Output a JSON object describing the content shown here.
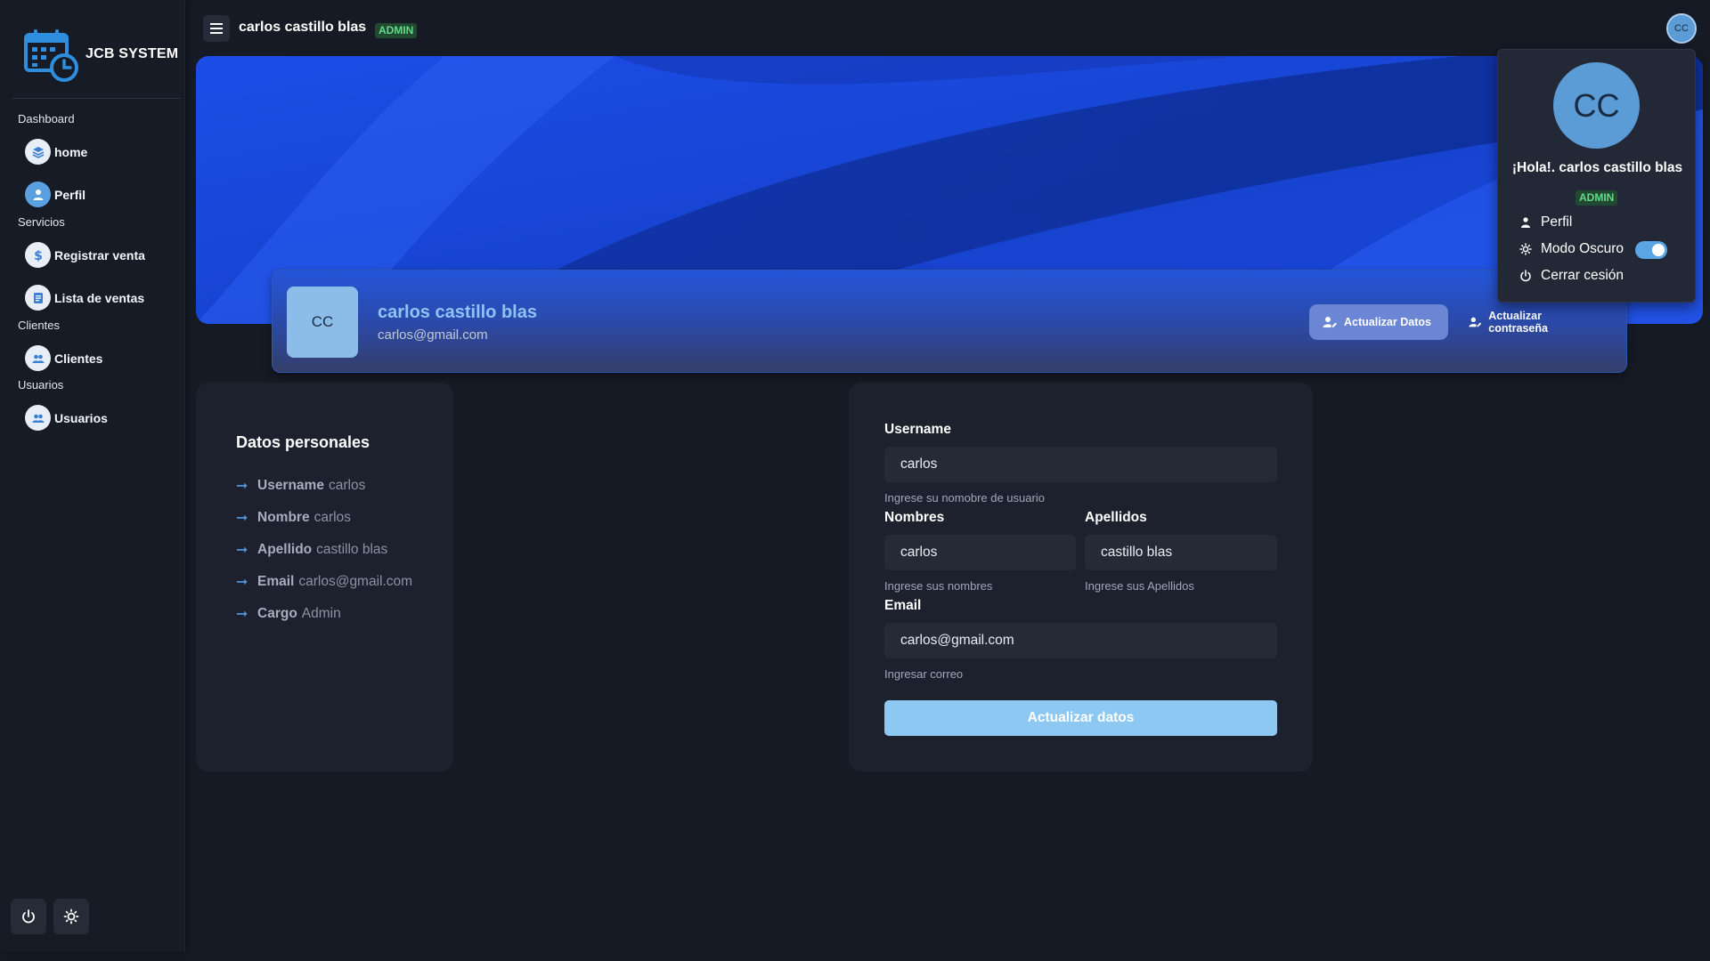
{
  "app": {
    "brand": "JCB SYSTEM"
  },
  "sidebar": {
    "sections": [
      {
        "title": "Dashboard",
        "items": [
          {
            "label": "home",
            "icon": "layers-icon"
          },
          {
            "label": "Perfil",
            "icon": "user-icon",
            "active": true
          }
        ]
      },
      {
        "title": "Servicios",
        "items": [
          {
            "label": "Registrar venta",
            "icon": "dollar-icon"
          },
          {
            "label": "Lista de ventas",
            "icon": "document-icon"
          }
        ]
      },
      {
        "title": "Clientes",
        "items": [
          {
            "label": "Clientes",
            "icon": "users-icon"
          }
        ]
      },
      {
        "title": "Usuarios",
        "items": [
          {
            "label": "Usuarios",
            "icon": "users-icon"
          }
        ]
      }
    ],
    "footer_buttons": [
      "power-icon",
      "sun-icon"
    ]
  },
  "header": {
    "user_name": "carlos castillo blas",
    "role_badge": "ADMIN",
    "avatar_initials": "CC"
  },
  "profile": {
    "initials": "CC",
    "name": "carlos castillo blas",
    "email": "carlos@gmail.com",
    "update_data_button": "Actualizar Datos",
    "update_password_button": "Actualizar contraseña"
  },
  "personal_data": {
    "title": "Datos personales",
    "rows": [
      {
        "key": "Username",
        "value": "carlos"
      },
      {
        "key": "Nombre",
        "value": "carlos"
      },
      {
        "key": "Apellido",
        "value": "castillo blas"
      },
      {
        "key": "Email",
        "value": "carlos@gmail.com"
      },
      {
        "key": "Cargo",
        "value": "Admin"
      }
    ]
  },
  "form": {
    "username": {
      "label": "Username",
      "value": "carlos",
      "help": "Ingrese su nomobre de usuario"
    },
    "nombres": {
      "label": "Nombres",
      "value": "carlos",
      "help": "Ingrese sus nombres"
    },
    "apellidos": {
      "label": "Apellidos",
      "value": "castillo blas",
      "help": "Ingrese sus Apellidos"
    },
    "email": {
      "label": "Email",
      "value": "carlos@gmail.com",
      "help": "Ingresar correo"
    },
    "submit": "Actualizar datos"
  },
  "dropdown": {
    "initials": "CC",
    "greeting": "¡Hola!. carlos castillo blas",
    "badge": "ADMIN",
    "items": {
      "perfil": "Perfil",
      "dark_mode": "Modo Oscuro",
      "logout": "Cerrar cesión"
    },
    "dark_mode_on": true
  },
  "colors": {
    "background": "#161a25",
    "card": "#1c212d",
    "accent": "#5aa0e0",
    "banner_blue": "#1a4fe0",
    "badge_green": "#64d98b"
  }
}
